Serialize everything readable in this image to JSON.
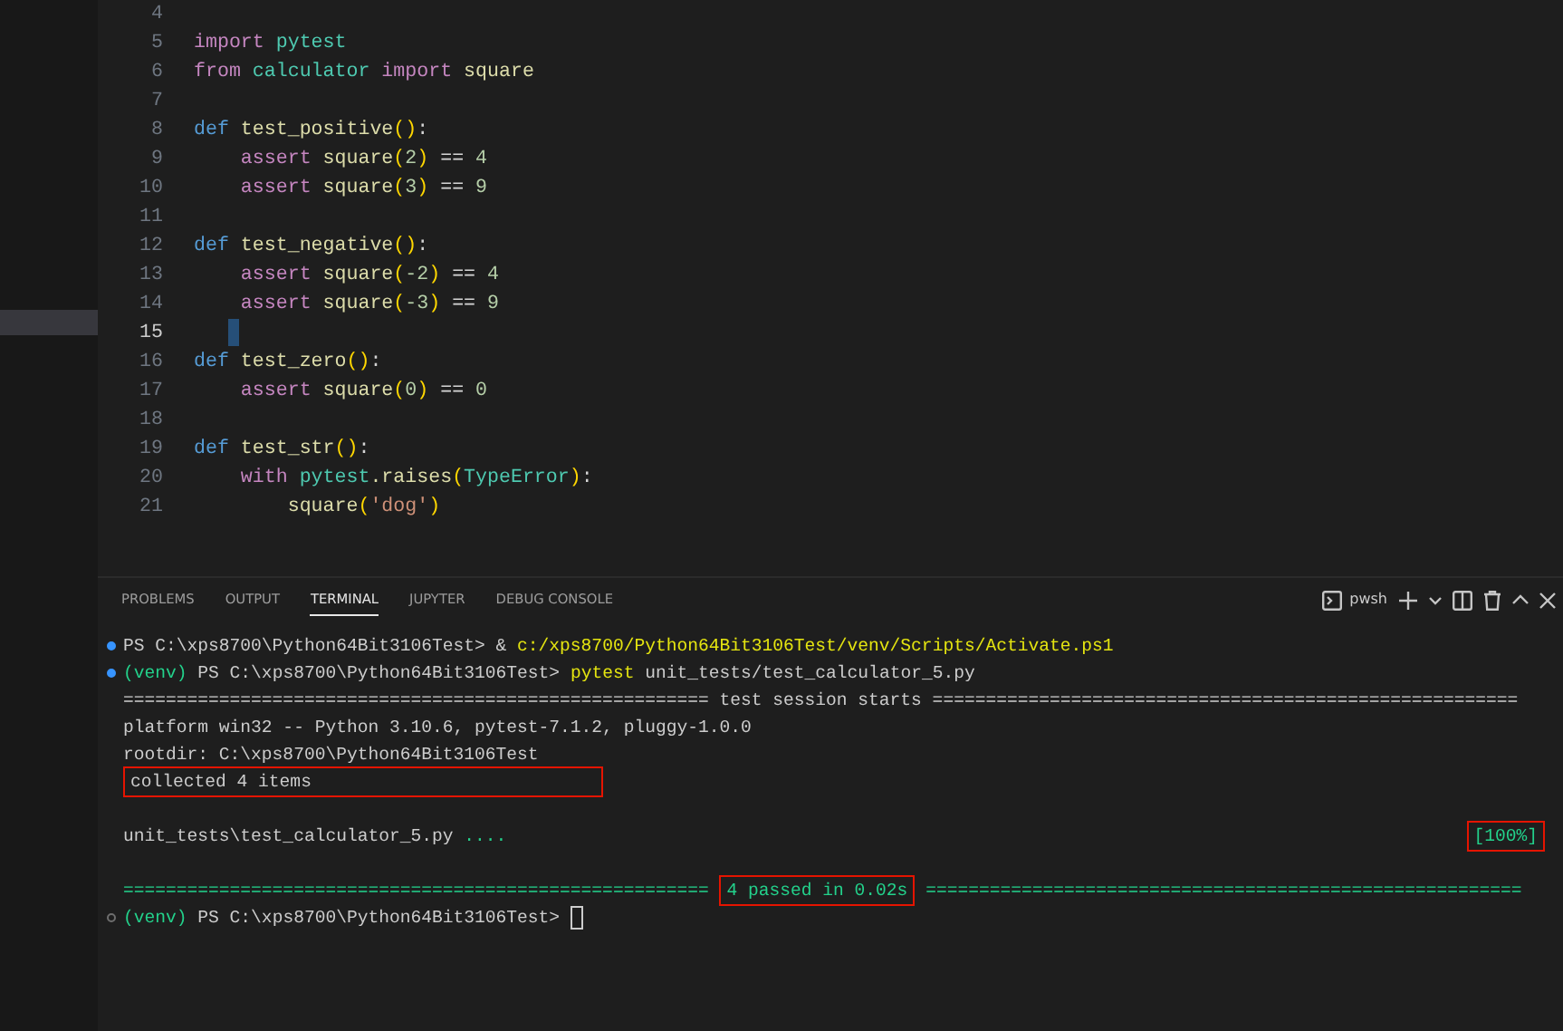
{
  "editor": {
    "lines": [
      {
        "number": "4",
        "current": false
      },
      {
        "number": "5",
        "current": false,
        "tokens": [
          {
            "text": "import",
            "kind": "keyword"
          },
          {
            "text": " pytest",
            "kind": "module"
          }
        ]
      },
      {
        "number": "6",
        "current": false,
        "tokens": [
          {
            "text": "from",
            "kind": "keyword"
          },
          {
            "text": " calculator",
            "kind": "module"
          },
          {
            "text": " import",
            "kind": "keyword"
          },
          {
            "text": " square",
            "kind": "function"
          }
        ]
      },
      {
        "number": "7",
        "current": false
      },
      {
        "number": "8",
        "current": false,
        "tokens": [
          {
            "text": "def",
            "kind": "def"
          },
          {
            "text": " test_positive",
            "kind": "function"
          },
          {
            "text": "()",
            "kind": "paren"
          },
          {
            "text": ":",
            "kind": "plain"
          }
        ]
      },
      {
        "number": "9",
        "current": false,
        "tokens": [
          {
            "text": "    assert",
            "kind": "keyword"
          },
          {
            "text": " square",
            "kind": "function"
          },
          {
            "text": "(",
            "kind": "paren"
          },
          {
            "text": "2",
            "kind": "number"
          },
          {
            "text": ")",
            "kind": "paren"
          },
          {
            "text": " == ",
            "kind": "plain"
          },
          {
            "text": "4",
            "kind": "number"
          }
        ]
      },
      {
        "number": "10",
        "current": false,
        "tokens": [
          {
            "text": "    assert",
            "kind": "keyword"
          },
          {
            "text": " square",
            "kind": "function"
          },
          {
            "text": "(",
            "kind": "paren"
          },
          {
            "text": "3",
            "kind": "number"
          },
          {
            "text": ")",
            "kind": "paren"
          },
          {
            "text": " == ",
            "kind": "plain"
          },
          {
            "text": "9",
            "kind": "number"
          }
        ]
      },
      {
        "number": "11",
        "current": false
      },
      {
        "number": "12",
        "current": false,
        "tokens": [
          {
            "text": "def",
            "kind": "def"
          },
          {
            "text": " test_negative",
            "kind": "function"
          },
          {
            "text": "()",
            "kind": "paren"
          },
          {
            "text": ":",
            "kind": "plain"
          }
        ]
      },
      {
        "number": "13",
        "current": false,
        "tokens": [
          {
            "text": "    assert",
            "kind": "keyword"
          },
          {
            "text": " square",
            "kind": "function"
          },
          {
            "text": "(",
            "kind": "paren"
          },
          {
            "text": "-2",
            "kind": "number"
          },
          {
            "text": ")",
            "kind": "paren"
          },
          {
            "text": " == ",
            "kind": "plain"
          },
          {
            "text": "4",
            "kind": "number"
          }
        ]
      },
      {
        "number": "14",
        "current": false,
        "tokens": [
          {
            "text": "    assert",
            "kind": "keyword"
          },
          {
            "text": " square",
            "kind": "function"
          },
          {
            "text": "(",
            "kind": "paren"
          },
          {
            "text": "-3",
            "kind": "number"
          },
          {
            "text": ")",
            "kind": "paren"
          },
          {
            "text": " == ",
            "kind": "plain"
          },
          {
            "text": "9",
            "kind": "number"
          }
        ]
      },
      {
        "number": "15",
        "current": true
      },
      {
        "number": "16",
        "current": false,
        "tokens": [
          {
            "text": "def",
            "kind": "def"
          },
          {
            "text": " test_zero",
            "kind": "function"
          },
          {
            "text": "()",
            "kind": "paren"
          },
          {
            "text": ":",
            "kind": "plain"
          }
        ]
      },
      {
        "number": "17",
        "current": false,
        "tokens": [
          {
            "text": "    assert",
            "kind": "keyword"
          },
          {
            "text": " square",
            "kind": "function"
          },
          {
            "text": "(",
            "kind": "paren"
          },
          {
            "text": "0",
            "kind": "number"
          },
          {
            "text": ")",
            "kind": "paren"
          },
          {
            "text": " == ",
            "kind": "plain"
          },
          {
            "text": "0",
            "kind": "number"
          }
        ]
      },
      {
        "number": "18",
        "current": false
      },
      {
        "number": "19",
        "current": false,
        "tokens": [
          {
            "text": "def",
            "kind": "def"
          },
          {
            "text": " test_str",
            "kind": "function"
          },
          {
            "text": "()",
            "kind": "paren"
          },
          {
            "text": ":",
            "kind": "plain"
          }
        ]
      },
      {
        "number": "20",
        "current": false,
        "tokens": [
          {
            "text": "    with",
            "kind": "keyword"
          },
          {
            "text": " pytest",
            "kind": "module"
          },
          {
            "text": ".raises",
            "kind": "function"
          },
          {
            "text": "(",
            "kind": "paren"
          },
          {
            "text": "TypeError",
            "kind": "module"
          },
          {
            "text": ")",
            "kind": "paren"
          },
          {
            "text": ":",
            "kind": "plain"
          }
        ]
      },
      {
        "number": "21",
        "current": false,
        "tokens": [
          {
            "text": "        square",
            "kind": "function"
          },
          {
            "text": "(",
            "kind": "paren"
          },
          {
            "text": "'dog'",
            "kind": "string"
          },
          {
            "text": ")",
            "kind": "paren"
          }
        ]
      }
    ]
  },
  "panel": {
    "tabs": [
      {
        "label": "PROBLEMS",
        "selected": false
      },
      {
        "label": "OUTPUT",
        "selected": false
      },
      {
        "label": "TERMINAL",
        "selected": true
      },
      {
        "label": "JUPYTER",
        "selected": false
      },
      {
        "label": "DEBUG CONSOLE",
        "selected": false
      }
    ],
    "shell": "pwsh"
  },
  "terminal": {
    "lines": [
      {
        "kind": "text",
        "marker": {
          "color": "#3794ff",
          "filled": true
        },
        "segments": [
          {
            "text": "PS C:\\xps8700\\Python64Bit3106Test> & ",
            "kind": "plain",
            "boxed": false
          },
          {
            "text": "c:/xps8700/Python64Bit3106Test/venv/Scripts/Activate.ps1",
            "kind": "command",
            "boxed": false
          }
        ]
      },
      {
        "kind": "text",
        "marker": {
          "color": "#3794ff",
          "filled": true
        },
        "segments": [
          {
            "text": "(venv)",
            "kind": "green",
            "boxed": false
          },
          {
            "text": " PS C:\\xps8700\\Python64Bit3106Test> ",
            "kind": "plain",
            "boxed": false
          },
          {
            "text": "pytest",
            "kind": "command",
            "boxed": false
          },
          {
            "text": " unit_tests/test_calculator_5.py",
            "kind": "plain",
            "boxed": false
          }
        ]
      },
      {
        "kind": "text",
        "segments": [
          {
            "text": "======================================================= test session starts =======================================================",
            "kind": "plain",
            "boxed": false
          }
        ]
      },
      {
        "kind": "text",
        "segments": [
          {
            "text": "platform win32 -- Python 3.10.6, pytest-7.1.2, pluggy-1.0.0",
            "kind": "plain",
            "boxed": false
          }
        ]
      },
      {
        "kind": "text",
        "segments": [
          {
            "text": "rootdir: C:\\xps8700\\Python64Bit3106Test",
            "kind": "plain",
            "boxed": false
          }
        ]
      },
      {
        "kind": "text",
        "segments": [
          {
            "text": "collected 4 items",
            "kind": "plain",
            "boxed": true
          }
        ]
      },
      {
        "kind": "blank"
      },
      {
        "kind": "text",
        "segments": [
          {
            "text": "unit_tests\\test_calculator_5.py ",
            "kind": "plain",
            "boxed": false
          },
          {
            "text": "....",
            "kind": "green",
            "boxed": false
          }
        ],
        "progress": {
          "text": "[100%]",
          "boxed": true
        }
      },
      {
        "kind": "blank"
      },
      {
        "kind": "text",
        "segments": [
          {
            "text": "======================================================= ",
            "kind": "green",
            "boxed": false
          },
          {
            "text": "4 passed in 0.02s",
            "kind": "green",
            "boxed": true
          },
          {
            "text": " ========================================================",
            "kind": "green",
            "boxed": false
          }
        ]
      },
      {
        "kind": "text",
        "marker": {
          "color": "#6e6e6e",
          "filled": false
        },
        "cursor": true,
        "segments": [
          {
            "text": "(venv)",
            "kind": "green",
            "boxed": false
          },
          {
            "text": " PS C:\\xps8700\\Python64Bit3106Test> ",
            "kind": "plain",
            "boxed": false
          }
        ]
      }
    ]
  }
}
